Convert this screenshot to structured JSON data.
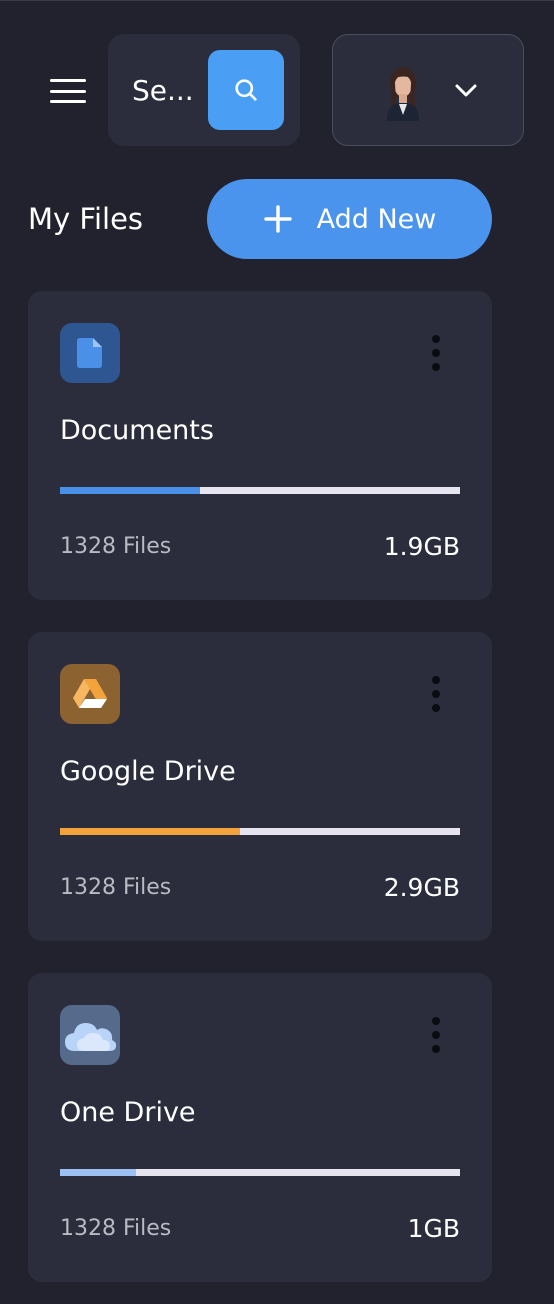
{
  "header": {
    "search": {
      "text": "Se...",
      "icon": "search-icon"
    },
    "profile": {
      "avatar": "avatar",
      "icon": "chevron-down-icon"
    }
  },
  "main": {
    "title": "My Files",
    "add_button": {
      "label": "Add New",
      "icon": "plus-icon"
    },
    "cards": [
      {
        "title": "Documents",
        "count": "1328 Files",
        "size": "1.9GB",
        "progress": 0.35,
        "color": "#4a90e8",
        "icon": "document-icon",
        "icon_bg": "#2e5690"
      },
      {
        "title": "Google Drive",
        "count": "1328 Files",
        "size": "2.9GB",
        "progress": 0.45,
        "color": "#f3a23c",
        "icon": "google-drive-icon",
        "icon_bg": "#8c6231"
      },
      {
        "title": "One Drive",
        "count": "1328 Files",
        "size": "1GB",
        "progress": 0.19,
        "color": "#9cc1f5",
        "icon": "cloud-icon",
        "icon_bg": "#566a8c"
      }
    ]
  },
  "colors": {
    "background": "#21222d",
    "card": "#2b2d3c",
    "accent": "#4a94ee",
    "progress_track": "#e6e4ee"
  }
}
